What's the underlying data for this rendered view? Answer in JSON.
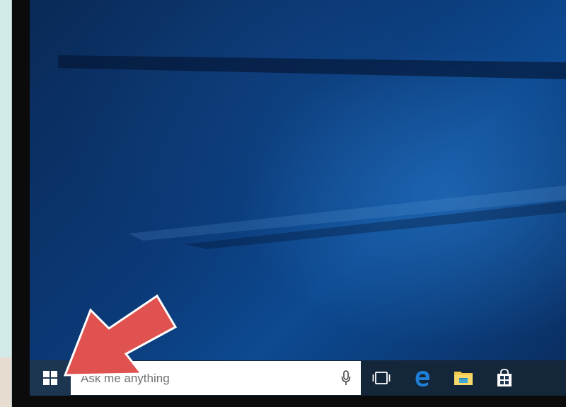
{
  "search": {
    "placeholder": "Ask me anything"
  },
  "taskbar": {
    "start_icon": "windows-logo-icon",
    "mic_icon": "microphone-icon",
    "pinned": [
      {
        "name": "task-view-icon"
      },
      {
        "name": "edge-icon"
      },
      {
        "name": "file-explorer-icon"
      },
      {
        "name": "store-icon"
      }
    ]
  },
  "annotation": {
    "arrow_icon": "red-arrow-icon",
    "color": "#e0524f"
  },
  "colors": {
    "taskbar": "#14263a",
    "accent_blue": "#1f7fd6",
    "folder": "#f3c94f"
  }
}
